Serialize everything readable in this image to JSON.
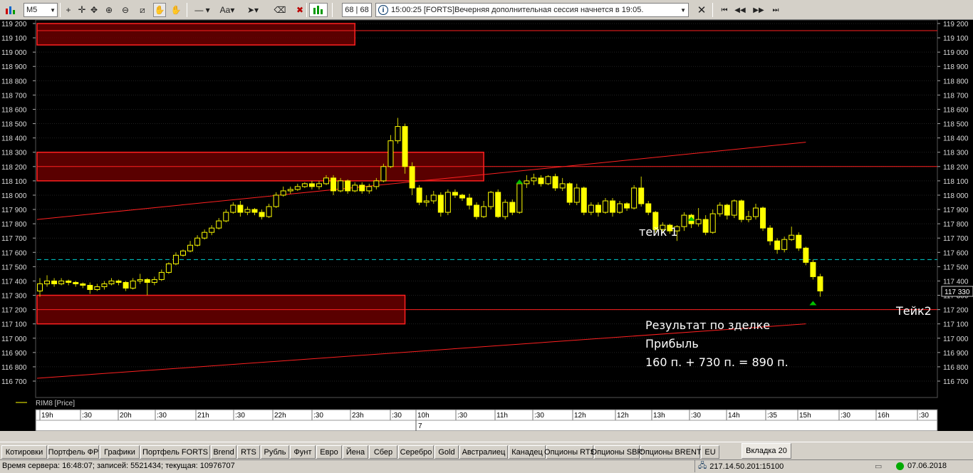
{
  "toolbar": {
    "timeframe": "M5",
    "counter": "68 | 68",
    "message": "15:00:25  [FORTS]Вечерняя дополнительная сессия начнется в 19:05.",
    "icons": [
      "plus-icon",
      "crosshair-icon",
      "zoom-in-icon",
      "zoom-out-icon",
      "ruler-icon",
      "hand-icon",
      "hand-icon",
      "line-icon",
      "text-icon",
      "cursor-icon",
      "eraser-icon",
      "delete-icon",
      "chart-type-icon",
      "close-icon",
      "first-icon",
      "prev-icon",
      "next-icon",
      "last-icon"
    ]
  },
  "chart": {
    "legend": "RIM8 [Price]",
    "last_price": "117 330",
    "date_marker": "7",
    "price_labels": [
      "119 200",
      "119 100",
      "119 000",
      "118 900",
      "118 800",
      "118 700",
      "118 600",
      "118 500",
      "118 400",
      "118 300",
      "118 200",
      "118 100",
      "118 000",
      "117 900",
      "117 800",
      "117 700",
      "117 600",
      "117 500",
      "117 400",
      "117 300",
      "117 200",
      "117 100",
      "117 000",
      "116 900",
      "116 800",
      "116 700"
    ],
    "time_labels": [
      "19h",
      ":30",
      "20h",
      ":30",
      "21h",
      ":30",
      "22h",
      ":30",
      "23h",
      ":30",
      "10h",
      ":30",
      "11h",
      ":30",
      "12h",
      "12h",
      "13h",
      ":30",
      "14h",
      ":35",
      "15h",
      ":30",
      "16h",
      ":30"
    ],
    "annotations": {
      "take1": "тейк 1",
      "take2": "Тейк2",
      "result_line1": "Результат по зделке",
      "result_line2": "Прибыль",
      "result_line3": "160 п. + 730 п. = 890 п."
    },
    "colors": {
      "candle": "#ffff00",
      "zone": "#ff0000",
      "support": "#00ffff",
      "arrow": "#00c000"
    }
  },
  "chart_data": {
    "type": "candlestick",
    "instrument": "RIM8",
    "ylim": [
      116650,
      119250
    ],
    "zones": [
      {
        "x0": 0,
        "x1": 44,
        "y_low": 119050,
        "y_high": 119200
      },
      {
        "x0": 0,
        "x1": 62,
        "y_low": 118100,
        "y_high": 118300
      },
      {
        "x0": 0,
        "x1": 51,
        "y_low": 117100,
        "y_high": 117300
      }
    ],
    "horizontal_levels": [
      119150,
      118200,
      117200
    ],
    "support_level": 117550,
    "trendlines": [
      {
        "x0": 0,
        "y0": 117830,
        "x1": 107,
        "y1": 118370
      },
      {
        "x0": 0,
        "y0": 116720,
        "x1": 107,
        "y1": 117100
      }
    ],
    "candles": [
      [
        117330,
        117380,
        117290,
        117420
      ],
      [
        117380,
        117400,
        117360,
        117440
      ],
      [
        117400,
        117380,
        117360,
        117420
      ],
      [
        117380,
        117400,
        117370,
        117420
      ],
      [
        117400,
        117390,
        117370,
        117410
      ],
      [
        117390,
        117380,
        117360,
        117400
      ],
      [
        117380,
        117370,
        117350,
        117390
      ],
      [
        117370,
        117340,
        117310,
        117390
      ],
      [
        117340,
        117360,
        117330,
        117380
      ],
      [
        117360,
        117380,
        117340,
        117400
      ],
      [
        117380,
        117400,
        117370,
        117420
      ],
      [
        117400,
        117390,
        117370,
        117410
      ],
      [
        117390,
        117350,
        117330,
        117400
      ],
      [
        117350,
        117400,
        117340,
        117420
      ],
      [
        117400,
        117410,
        117380,
        117450
      ],
      [
        117410,
        117390,
        117300,
        117420
      ],
      [
        117390,
        117410,
        117370,
        117430
      ],
      [
        117410,
        117460,
        117400,
        117480
      ],
      [
        117460,
        117520,
        117450,
        117530
      ],
      [
        117520,
        117580,
        117510,
        117600
      ],
      [
        117580,
        117610,
        117570,
        117620
      ],
      [
        117610,
        117650,
        117600,
        117680
      ],
      [
        117650,
        117700,
        117640,
        117720
      ],
      [
        117700,
        117740,
        117690,
        117760
      ],
      [
        117740,
        117770,
        117720,
        117790
      ],
      [
        117770,
        117820,
        117760,
        117840
      ],
      [
        117820,
        117880,
        117810,
        117900
      ],
      [
        117880,
        117930,
        117870,
        117950
      ],
      [
        117930,
        117880,
        117850,
        117960
      ],
      [
        117880,
        117900,
        117860,
        117920
      ],
      [
        117900,
        117880,
        117860,
        117910
      ],
      [
        117880,
        117850,
        117830,
        117900
      ],
      [
        117850,
        117920,
        117840,
        117940
      ],
      [
        117920,
        118000,
        117910,
        118020
      ],
      [
        118000,
        118030,
        117990,
        118060
      ],
      [
        118030,
        118040,
        118010,
        118060
      ],
      [
        118040,
        118060,
        118030,
        118080
      ],
      [
        118060,
        118080,
        118050,
        118090
      ],
      [
        118080,
        118060,
        118040,
        118100
      ],
      [
        118060,
        118080,
        118040,
        118100
      ],
      [
        118080,
        118120,
        118070,
        118140
      ],
      [
        118120,
        118030,
        118000,
        118140
      ],
      [
        118030,
        118100,
        118020,
        118120
      ],
      [
        118100,
        118030,
        118010,
        118110
      ],
      [
        118030,
        118070,
        118020,
        118090
      ],
      [
        118070,
        118030,
        118010,
        118090
      ],
      [
        118030,
        118060,
        118010,
        118080
      ],
      [
        118060,
        118100,
        118040,
        118120
      ],
      [
        118100,
        118200,
        118090,
        118220
      ],
      [
        118200,
        118380,
        118190,
        118420
      ],
      [
        118380,
        118480,
        118360,
        118540
      ],
      [
        118480,
        118200,
        118150,
        118500
      ],
      [
        118200,
        118050,
        118000,
        118230
      ],
      [
        118050,
        117950,
        117930,
        118070
      ],
      [
        117950,
        117960,
        117920,
        118000
      ],
      [
        117960,
        118000,
        117940,
        118030
      ],
      [
        118000,
        117880,
        117850,
        118020
      ],
      [
        117880,
        118020,
        117860,
        118040
      ],
      [
        118020,
        118000,
        117980,
        118040
      ],
      [
        118000,
        117980,
        117960,
        118010
      ],
      [
        117980,
        117930,
        117900,
        118010
      ],
      [
        117930,
        117850,
        117830,
        117950
      ],
      [
        117850,
        117920,
        117840,
        117960
      ],
      [
        117920,
        118020,
        117900,
        118030
      ],
      [
        118020,
        117850,
        117840,
        118040
      ],
      [
        117850,
        117950,
        117830,
        117970
      ],
      [
        117950,
        117880,
        117860,
        117970
      ],
      [
        117880,
        118080,
        117870,
        118100
      ],
      [
        118080,
        118100,
        118050,
        118140
      ],
      [
        118100,
        118120,
        118070,
        118150
      ],
      [
        118120,
        118080,
        118060,
        118140
      ],
      [
        118080,
        118130,
        118070,
        118140
      ],
      [
        118130,
        118050,
        118030,
        118150
      ],
      [
        118050,
        118080,
        118030,
        118120
      ],
      [
        118080,
        117950,
        117930,
        118090
      ],
      [
        117950,
        118050,
        117930,
        118080
      ],
      [
        118050,
        117880,
        117860,
        118060
      ],
      [
        117880,
        117930,
        117860,
        117950
      ],
      [
        117930,
        117880,
        117850,
        117950
      ],
      [
        117880,
        117960,
        117870,
        117980
      ],
      [
        117960,
        117880,
        117850,
        117980
      ],
      [
        117880,
        117940,
        117870,
        117960
      ],
      [
        117940,
        117910,
        117890,
        117950
      ],
      [
        117910,
        118050,
        117900,
        118070
      ],
      [
        118050,
        117940,
        117920,
        118130
      ],
      [
        117940,
        117880,
        117860,
        117960
      ],
      [
        117880,
        117760,
        117740,
        117890
      ],
      [
        117760,
        117790,
        117740,
        117810
      ],
      [
        117790,
        117750,
        117730,
        117800
      ],
      [
        117750,
        117780,
        117680,
        117790
      ],
      [
        117780,
        117860,
        117750,
        117880
      ],
      [
        117860,
        117800,
        117770,
        117870
      ],
      [
        117800,
        117830,
        117780,
        117910
      ],
      [
        117830,
        117740,
        117720,
        117860
      ],
      [
        117740,
        117870,
        117730,
        117900
      ],
      [
        117870,
        117930,
        117850,
        117950
      ],
      [
        117930,
        117860,
        117830,
        117940
      ],
      [
        117860,
        117960,
        117840,
        117970
      ],
      [
        117960,
        117830,
        117810,
        117970
      ],
      [
        117830,
        117850,
        117810,
        117890
      ],
      [
        117850,
        117910,
        117830,
        117940
      ],
      [
        117910,
        117770,
        117750,
        117920
      ],
      [
        117770,
        117680,
        117650,
        117790
      ],
      [
        117680,
        117620,
        117590,
        117700
      ],
      [
        117620,
        117690,
        117600,
        117710
      ],
      [
        117690,
        117720,
        117680,
        117780
      ],
      [
        117720,
        117630,
        117610,
        117740
      ],
      [
        117630,
        117530,
        117510,
        117640
      ],
      [
        117530,
        117430,
        117410,
        117550
      ],
      [
        117430,
        117330,
        117290,
        117450
      ]
    ],
    "take_markers": [
      {
        "index": 67,
        "price": 118140,
        "label": "тейк 1"
      },
      {
        "index": 91,
        "price": 117880,
        "label": ""
      },
      {
        "index": 108,
        "price": 117290,
        "label": "Тейк2"
      }
    ]
  },
  "tabs": [
    {
      "label": "Котировки"
    },
    {
      "label": "Портфель ФР"
    },
    {
      "label": "Графики"
    },
    {
      "label": "Портфель FORTS"
    },
    {
      "label": "Brend"
    },
    {
      "label": "RTS"
    },
    {
      "label": "Рубль"
    },
    {
      "label": "Фунт"
    },
    {
      "label": "Евро"
    },
    {
      "label": "Йена"
    },
    {
      "label": "Сбер"
    },
    {
      "label": "Серебро"
    },
    {
      "label": "Gold"
    },
    {
      "label": "Австралиец"
    },
    {
      "label": "Канадец"
    },
    {
      "label": "Опционы RTS"
    },
    {
      "label": "Опционы SBR"
    },
    {
      "label": "Опционы BRENT"
    },
    {
      "label": "EU"
    },
    {
      "label": "Вкладка 20"
    }
  ],
  "status": {
    "server_info": "Время сервера: 16:48:07; записей: 5521434; текущая: 10976707",
    "connection": "217.14.50.201:15100",
    "date": "07.06.2018"
  }
}
